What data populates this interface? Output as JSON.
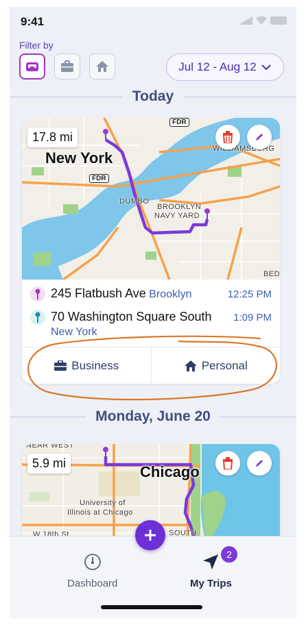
{
  "status_bar": {
    "time": "9:41"
  },
  "filter": {
    "label": "Filter by",
    "buttons": [
      {
        "icon": "inbox-icon",
        "active": true
      },
      {
        "icon": "briefcase-icon",
        "active": false
      },
      {
        "icon": "home-icon",
        "active": false
      }
    ],
    "date_range": "Jul 12 - Aug 12"
  },
  "sections": [
    {
      "title": "Today",
      "trip": {
        "distance": "17.8 mi",
        "map_labels": {
          "city": "New York",
          "fdr1": "FDR",
          "fdr2": "FDR",
          "dumbo": "DUMBO",
          "williamsburg": "WILLIAMSBURG",
          "navy_yard_1": "BROOKLYN",
          "navy_yard_2": "NAVY YARD",
          "bed": "BED"
        },
        "start": {
          "address": "245 Flatbush Ave",
          "city": "Brooklyn",
          "time": "12:25 PM"
        },
        "end": {
          "address": "70 Washington Square South",
          "city": "New York",
          "time": "1:09 PM"
        },
        "actions": {
          "business": "Business",
          "personal": "Personal"
        }
      }
    },
    {
      "title": "Monday, June 20",
      "trip": {
        "distance": "5.9 mi",
        "map_labels": {
          "city": "Chicago",
          "top": "NEAR WEST",
          "university": "University of",
          "university2": "Illinois at Chicago",
          "street": "W 18th St",
          "south": "SOUTH"
        }
      }
    }
  ],
  "tabs": [
    {
      "label": "Dashboard",
      "icon": "gauge-icon",
      "active": false
    },
    {
      "label": "My Trips",
      "icon": "navigation-arrow-icon",
      "active": true,
      "badge": "2"
    }
  ],
  "colors": {
    "accent": "#6d2fd6",
    "route": "#7a3ad8",
    "annotation": "#d9782a"
  }
}
